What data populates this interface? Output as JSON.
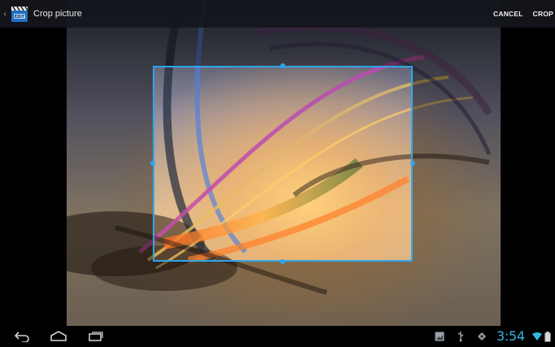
{
  "action_bar": {
    "title": "Crop picture",
    "cancel_label": "CANCEL",
    "crop_label": "CROP",
    "app_icon": "clapperboard-app-icon",
    "up_icon": "back-caret-icon"
  },
  "system_bar": {
    "time": "3:54",
    "nav_icons": [
      "back-icon",
      "home-icon",
      "recent-apps-icon"
    ],
    "status_icons": [
      "gallery-notification-icon",
      "usb-icon",
      "debug-icon",
      "wifi-icon",
      "battery-icon"
    ]
  },
  "colors": {
    "crop_accent": "#2fa6e8",
    "clock": "#33b5e5",
    "action_bar": "#14161c"
  }
}
